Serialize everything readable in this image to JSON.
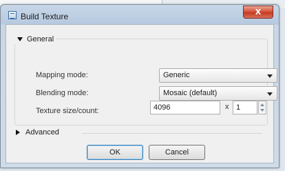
{
  "window": {
    "title": "Build Texture",
    "close_symbol": "X"
  },
  "general": {
    "header": "General",
    "mapping_label": "Mapping mode:",
    "mapping_value": "Generic",
    "blending_label": "Blending mode:",
    "blending_value": "Mosaic (default)",
    "size_label": "Texture size/count:",
    "size_value": "4096",
    "times_symbol": "x",
    "count_value": "1"
  },
  "advanced": {
    "header": "Advanced"
  },
  "buttons": {
    "ok": "OK",
    "cancel": "Cancel"
  },
  "icons": {
    "window": "app-window-icon",
    "close": "close-icon",
    "general_toggle": "triangle-down-icon",
    "advanced_toggle": "triangle-right-icon",
    "dropdown": "chevron-down-icon",
    "spin": "spin-arrows-icon"
  }
}
